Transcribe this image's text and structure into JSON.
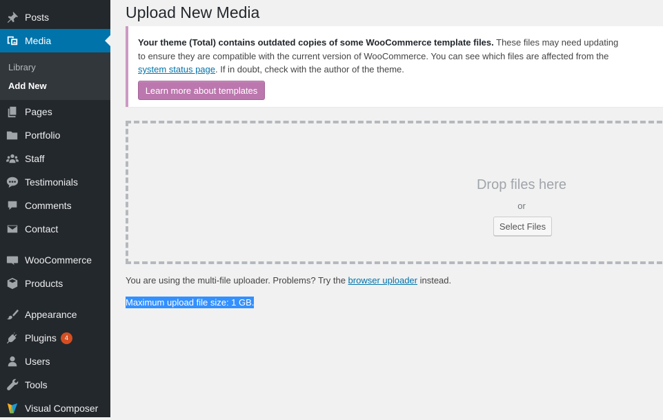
{
  "sidebar": {
    "items": [
      {
        "label": "Posts",
        "icon": "pin-icon"
      },
      {
        "label": "Media",
        "icon": "media-icon"
      },
      {
        "label": "Pages",
        "icon": "pages-icon"
      },
      {
        "label": "Portfolio",
        "icon": "folder-icon"
      },
      {
        "label": "Staff",
        "icon": "groups-icon"
      },
      {
        "label": "Testimonials",
        "icon": "chat-bubble-icon"
      },
      {
        "label": "Comments",
        "icon": "comment-icon"
      },
      {
        "label": "Contact",
        "icon": "mail-icon"
      },
      {
        "label": "WooCommerce",
        "icon": "woo-icon"
      },
      {
        "label": "Products",
        "icon": "cube-icon"
      },
      {
        "label": "Appearance",
        "icon": "brush-icon"
      },
      {
        "label": "Plugins",
        "icon": "plug-icon",
        "badge": "4"
      },
      {
        "label": "Users",
        "icon": "user-icon"
      },
      {
        "label": "Tools",
        "icon": "wrench-icon"
      },
      {
        "label": "Visual Composer",
        "icon": "vc-icon"
      }
    ],
    "submenu": {
      "library": "Library",
      "add_new": "Add New"
    }
  },
  "main": {
    "title": "Upload New Media",
    "notice": {
      "bold": "Your theme (Total) contains outdated copies of some WooCommerce template files.",
      "text1": " These files may need updating to ensure they are compatible with the current version of WooCommerce. You can see which files are affected from the ",
      "link": "system status page",
      "text2": ". If in doubt, check with the author of the theme.",
      "button": "Learn more about templates"
    },
    "dropzone": {
      "title": "Drop files here",
      "or": "or",
      "button": "Select Files"
    },
    "uploader": {
      "prefix": "You are using the multi-file uploader. Problems? Try the ",
      "link": "browser uploader",
      "suffix": " instead."
    },
    "max_size": "Maximum upload file size: 1 GB."
  },
  "colors": {
    "sidebar": "#23282d",
    "accent": "#0073aa",
    "woo_button": "#bb77ae",
    "badge": "#d54e21",
    "selection": "#3390ff"
  }
}
